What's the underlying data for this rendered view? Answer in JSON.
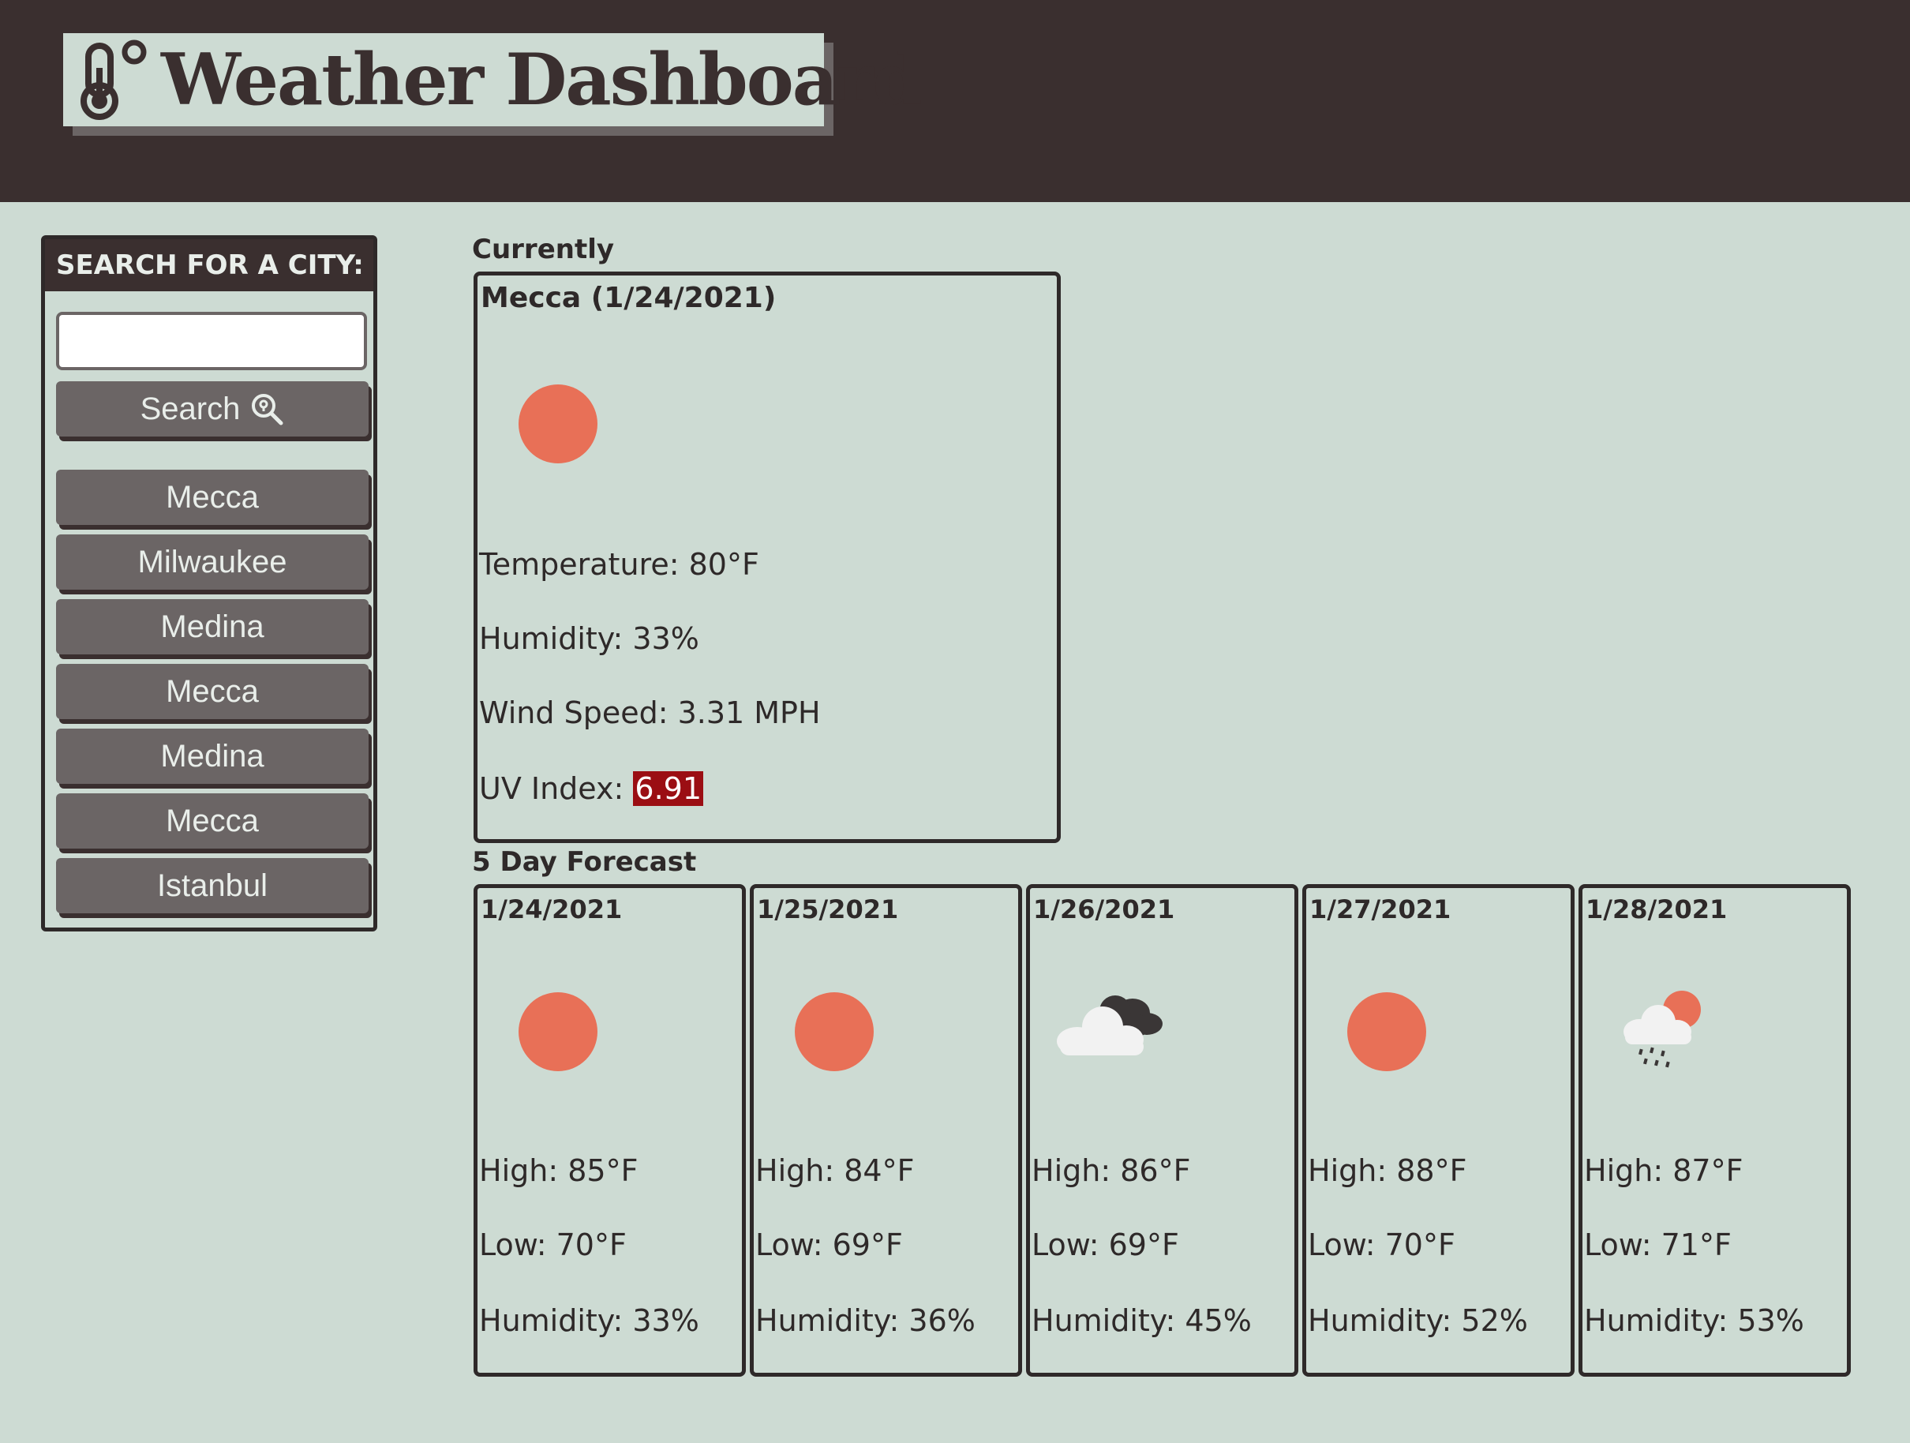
{
  "header": {
    "title": "Weather Dashboard"
  },
  "sidebar": {
    "heading": "SEARCH FOR A CITY:",
    "search_value": "",
    "search_placeholder": "",
    "search_button_label": "Search",
    "history": [
      "Mecca",
      "Milwaukee",
      "Medina",
      "Mecca",
      "Medina",
      "Mecca",
      "Istanbul"
    ]
  },
  "current": {
    "section_label": "Currently",
    "title": "Mecca (1/24/2021)",
    "icon": "sun-icon",
    "temperature": "Temperature: 80°F",
    "humidity": "Humidity: 33%",
    "wind": "Wind Speed: 3.31 MPH",
    "uv_label": "UV Index:",
    "uv_value": "6.91"
  },
  "forecast": {
    "section_label": "5 Day Forecast",
    "days": [
      {
        "date": "1/24/2021",
        "icon": "sun-icon",
        "high": "High: 85°F",
        "low": "Low: 70°F",
        "humidity": "Humidity: 33%"
      },
      {
        "date": "1/25/2021",
        "icon": "sun-icon",
        "high": "High: 84°F",
        "low": "Low: 69°F",
        "humidity": "Humidity: 36%"
      },
      {
        "date": "1/26/2021",
        "icon": "cloudy-icon",
        "high": "High: 86°F",
        "low": "Low: 69°F",
        "humidity": "Humidity: 45%"
      },
      {
        "date": "1/27/2021",
        "icon": "sun-icon",
        "high": "High: 88°F",
        "low": "Low: 70°F",
        "humidity": "Humidity: 52%"
      },
      {
        "date": "1/28/2021",
        "icon": "rain-sun-icon",
        "high": "High: 87°F",
        "low": "Low: 71°F",
        "humidity": "Humidity: 53%"
      }
    ]
  },
  "colors": {
    "background": "#cddbd3",
    "header": "#3a2f2f",
    "button": "#6b6565",
    "sun": "#e87057",
    "uv_badge": "#9b0e13"
  }
}
